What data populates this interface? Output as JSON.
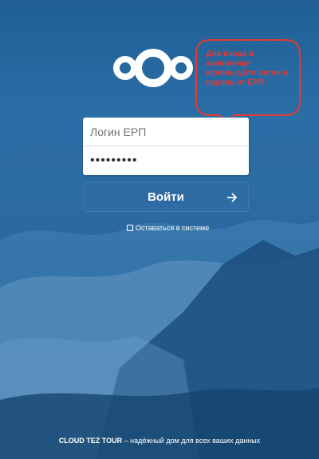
{
  "logo": {
    "icon": "cloud-logo-icon",
    "color": "#ffffff"
  },
  "hint": {
    "text": "Для входа в хранилище используйте логин и пароль от ЕРП",
    "color": "#e53935"
  },
  "login": {
    "placeholder": "Логин ЕРП",
    "password_value": "•••••••••",
    "submit_label": "Войти",
    "submit_icon": "arrow-right-icon",
    "remember_label": "Оставаться в системе"
  },
  "footer": {
    "brand": "CLOUD TEZ TOUR",
    "tagline": " – надёжный дом для всех ваших данных"
  },
  "colors": {
    "button": "#2e6ca3",
    "background_top": "#1f5f95",
    "background_bottom": "#174a78"
  }
}
